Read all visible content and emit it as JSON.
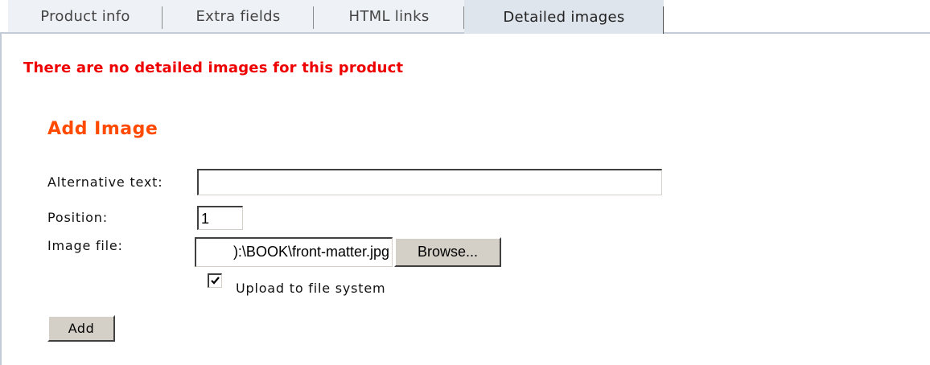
{
  "tabs": [
    {
      "label": "Product info",
      "active": false
    },
    {
      "label": "Extra fields",
      "active": false
    },
    {
      "label": "HTML links",
      "active": false
    },
    {
      "label": "Detailed images",
      "active": true
    }
  ],
  "notice": "There are no detailed images for this product",
  "form": {
    "heading": "Add Image",
    "alt_text_label": "Alternative text:",
    "alt_text_value": "",
    "position_label": "Position:",
    "position_value": "1",
    "image_file_label": "Image file:",
    "image_file_value": "):\\BOOK\\front-matter.jpg",
    "browse_label": "Browse...",
    "upload_label": "Upload to file system",
    "upload_checked": true,
    "add_label": "Add"
  },
  "colors": {
    "notice": "#ee0000",
    "heading": "#ff4a00",
    "tab_bg": "#eef1f5",
    "tab_active_bg": "#dfe5ec",
    "button_face": "#d4d0c8"
  }
}
